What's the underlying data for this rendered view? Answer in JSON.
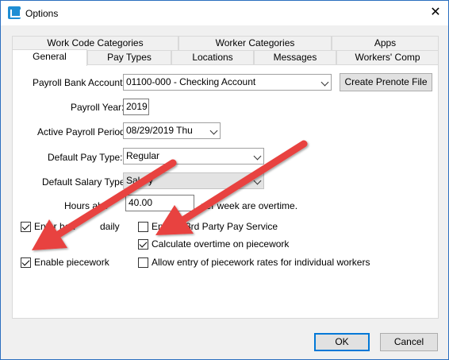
{
  "window": {
    "title": "Options"
  },
  "tabs": {
    "row_back": [
      "Work Code Categories",
      "Worker Categories",
      "Apps"
    ],
    "row_front": [
      "General",
      "Pay Types",
      "Locations",
      "Messages",
      "Workers' Comp"
    ],
    "active": "General"
  },
  "general": {
    "bank_account": {
      "label": "Payroll Bank Account:",
      "value": "01100-000 - Checking Account"
    },
    "prenote_button": "Create Prenote File",
    "payroll_year": {
      "label": "Payroll Year:",
      "value": "2019"
    },
    "active_period": {
      "label": "Active Payroll Period:",
      "value": "08/29/2019 Thu"
    },
    "default_pay_type": {
      "label": "Default Pay Type:",
      "value": "Regular"
    },
    "default_salary_type": {
      "label": "Default Salary Type:",
      "value": "Salary"
    },
    "hours": {
      "label_before": "Hours abo",
      "value": "40.00",
      "label_after": "per week are overtime."
    },
    "checkboxes": {
      "enter_hours_daily": {
        "label": "Enter hou",
        "label_tail": "daily",
        "checked": true
      },
      "enable_piecework": {
        "label": "Enable piecework",
        "checked": true
      },
      "third_party": {
        "label": "En",
        "label_tail": "3rd Party Pay Service",
        "checked": false
      },
      "calc_overtime": {
        "label": "Calculate overtime on piecework",
        "checked": true
      },
      "allow_rates": {
        "label": "Allow entry of piecework rates for individual workers",
        "checked": false
      }
    }
  },
  "buttons": {
    "ok": "OK",
    "cancel": "Cancel"
  },
  "colors": {
    "arrow": "#e8433f",
    "accent": "#0078d7"
  },
  "icons": {
    "app": "app-icon",
    "close": "close-icon"
  }
}
